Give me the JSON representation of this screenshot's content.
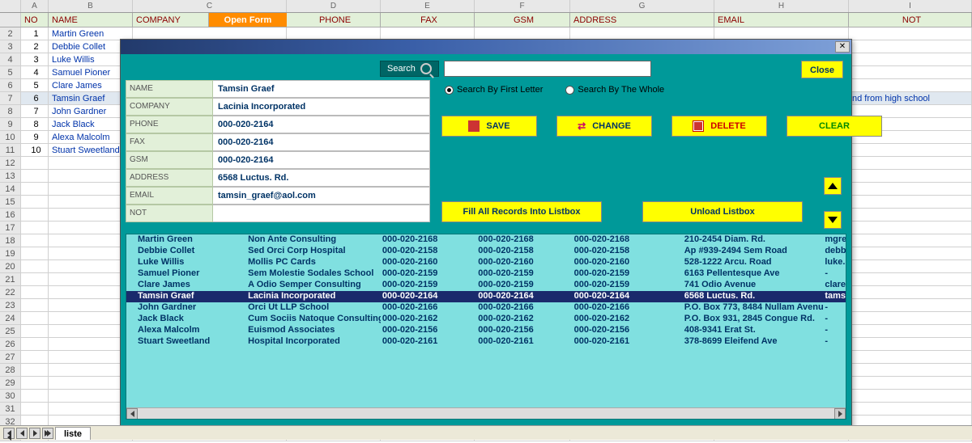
{
  "columns": {
    "letters": [
      "",
      "A",
      "B",
      "C",
      "D",
      "E",
      "F",
      "G",
      "H",
      "I"
    ],
    "headers": [
      "NO",
      "NAME",
      "COMPANY",
      "PHONE",
      "FAX",
      "GSM",
      "ADDRESS",
      "EMAIL",
      "NOT"
    ],
    "open_form": "Open Form"
  },
  "sheet_rows": [
    {
      "no": "1",
      "name": "Martin Green",
      "not": ""
    },
    {
      "no": "2",
      "name": "Debbie Collet",
      "not": ""
    },
    {
      "no": "3",
      "name": "Luke Willis",
      "not": ""
    },
    {
      "no": "4",
      "name": "Samuel Pioner",
      "not": ""
    },
    {
      "no": "5",
      "name": "Clare James",
      "not": ""
    },
    {
      "no": "6",
      "name": "Tamsin Graef",
      "not": "nd from high school"
    },
    {
      "no": "7",
      "name": "John Gardner",
      "not": ""
    },
    {
      "no": "8",
      "name": "Jack Black",
      "not": ""
    },
    {
      "no": "9",
      "name": "Alexa Malcolm",
      "not": ""
    },
    {
      "no": "10",
      "name": "Stuart Sweetland",
      "not": ""
    }
  ],
  "selected_sheet_row": 5,
  "search": {
    "label": "Search",
    "value": ""
  },
  "close_btn": "Close",
  "radios": {
    "first_letter": "Search By First Letter",
    "whole": "Search By The Whole",
    "selected": "first_letter"
  },
  "form": {
    "labels": {
      "name": "NAME",
      "company": "COMPANY",
      "phone": "PHONE",
      "fax": "FAX",
      "gsm": "GSM",
      "address": "ADDRESS",
      "email": "EMAIL",
      "not": "NOT"
    },
    "values": {
      "name": "Tamsin Graef",
      "company": "Lacinia  Incorporated",
      "phone": "000-020-2164",
      "fax": "000-020-2164",
      "gsm": "000-020-2164",
      "address": "6568 Luctus. Rd.",
      "email": "tamsin_graef@aol.com",
      "not": ""
    }
  },
  "actions": {
    "save": "SAVE",
    "change": "CHANGE",
    "delete": "DELETE",
    "clear": "CLEAR"
  },
  "fill_btn": "Fill All Records Into Listbox",
  "unload_btn": "Unload Listbox",
  "listbox": {
    "selected": 5,
    "rows": [
      {
        "name": "Martin Green",
        "company": "Non Ante Consulting",
        "phone": "000-020-2168",
        "fax": "000-020-2168",
        "gsm": "000-020-2168",
        "address": "210-2454 Diam. Rd.",
        "email": "mgre"
      },
      {
        "name": "Debbie Collet",
        "company": "Sed Orci Corp Hospital",
        "phone": "000-020-2158",
        "fax": "000-020-2158",
        "gsm": "000-020-2158",
        "address": "Ap #939-2494 Sem Road",
        "email": "debb"
      },
      {
        "name": "Luke Willis",
        "company": "Mollis PC Cards",
        "phone": "000-020-2160",
        "fax": "000-020-2160",
        "gsm": "000-020-2160",
        "address": "528-1222 Arcu. Road",
        "email": "luke."
      },
      {
        "name": "Samuel Pioner",
        "company": "Sem Molestie Sodales School",
        "phone": "000-020-2159",
        "fax": "000-020-2159",
        "gsm": "000-020-2159",
        "address": "6163 Pellentesque Ave",
        "email": "-"
      },
      {
        "name": "Clare James",
        "company": "A Odio Semper Consulting",
        "phone": "000-020-2159",
        "fax": "000-020-2159",
        "gsm": "000-020-2159",
        "address": "741 Odio Avenue",
        "email": "clare"
      },
      {
        "name": "Tamsin Graef",
        "company": "Lacinia  Incorporated",
        "phone": "000-020-2164",
        "fax": "000-020-2164",
        "gsm": "000-020-2164",
        "address": "6568 Luctus. Rd.",
        "email": "tams"
      },
      {
        "name": "John Gardner",
        "company": "Orci Ut LLP School",
        "phone": "000-020-2166",
        "fax": "000-020-2166",
        "gsm": "000-020-2166",
        "address": "P.O. Box 773, 8484 Nullam Avenue",
        "email": "-"
      },
      {
        "name": "Jack Black",
        "company": "Cum Sociis Natoque Consulting",
        "phone": "000-020-2162",
        "fax": "000-020-2162",
        "gsm": "000-020-2162",
        "address": "P.O. Box 931, 2845 Congue Rd.",
        "email": "-"
      },
      {
        "name": "Alexa Malcolm",
        "company": "Euismod Associates",
        "phone": "000-020-2156",
        "fax": "000-020-2156",
        "gsm": "000-020-2156",
        "address": "408-9341 Erat St.",
        "email": "-"
      },
      {
        "name": "Stuart Sweetland",
        "company": "Hospital Incorporated",
        "phone": "000-020-2161",
        "fax": "000-020-2161",
        "gsm": "000-020-2161",
        "address": "378-8699 Eleifend Ave",
        "email": "-"
      }
    ]
  },
  "tab_name": "liste"
}
